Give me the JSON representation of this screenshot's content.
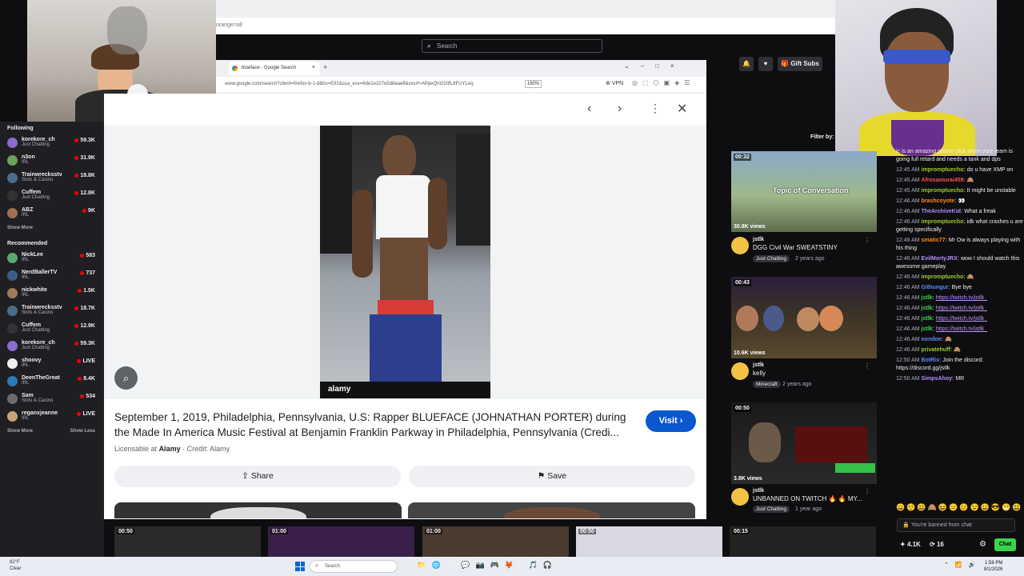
{
  "twitch": {
    "search_placeholder": "Search",
    "gift_subs": "Gift Subs",
    "filter_by": "Filter by:",
    "sidebar": {
      "following_title": "Following",
      "recommended_title": "Recommended",
      "show_more": "Show More",
      "show_less": "Show Less",
      "following": [
        {
          "name": "korekore_ch",
          "category": "Just Chatting",
          "viewers": "59.3K",
          "color": "#8a6bd1"
        },
        {
          "name": "n3on",
          "category": "IRL",
          "viewers": "31.9K",
          "color": "#6aa35b"
        },
        {
          "name": "Trainwrecksstv",
          "category": "Slots & Casino",
          "viewers": "18.8K",
          "color": "#4b6d8c"
        },
        {
          "name": "Cuffem",
          "category": "Just Chatting",
          "viewers": "12.8K",
          "color": "#333"
        },
        {
          "name": "ABZ",
          "category": "IRL",
          "viewers": "9K",
          "color": "#a06f4f"
        }
      ],
      "recommended": [
        {
          "name": "NickLee",
          "category": "IRL",
          "viewers": "583",
          "color": "#5ca86b"
        },
        {
          "name": "NerdBallerTV",
          "category": "IRL",
          "viewers": "737",
          "color": "#3d5c8a"
        },
        {
          "name": "nickwhite",
          "category": "IRL",
          "viewers": "1.5K",
          "color": "#9c7a5a"
        },
        {
          "name": "Trainwrecksstv",
          "category": "Slots & Casino",
          "viewers": "18.7K",
          "color": "#4b6d8c"
        },
        {
          "name": "Cuffem",
          "category": "Just Chatting",
          "viewers": "12.9K",
          "color": "#333"
        },
        {
          "name": "korekore_ch",
          "category": "Just Chatting",
          "viewers": "59.3K",
          "color": "#8a6bd1"
        },
        {
          "name": "shoovy",
          "category": "IRL",
          "viewers": "LIVE",
          "color": "#eeeeee"
        },
        {
          "name": "DeenTheGreat",
          "category": "IRL",
          "viewers": "8.4K",
          "color": "#2a7ab5"
        },
        {
          "name": "Sam",
          "category": "Slots & Casino",
          "viewers": "534",
          "color": "#6c6c6c"
        },
        {
          "name": "reganxjeanne",
          "category": "IRL",
          "viewers": "LIVE",
          "color": "#c9a27a"
        }
      ]
    },
    "videos": [
      {
        "duration": "00:32",
        "views": "30.8K views",
        "channel": "jstlk",
        "title": "DGG Civil War SWEATSTINY",
        "tag": "Just Chatting",
        "ago": "2 years ago",
        "overlay": "Topic of Conversation"
      },
      {
        "duration": "00:43",
        "views": "10.6K views",
        "channel": "jstlk",
        "title": "kelly",
        "tag": "Minecraft",
        "ago": "2 years ago"
      },
      {
        "duration": "00:50",
        "views": "3.8K views",
        "channel": "jstlk",
        "title": "UNBANNED ON TWITCH 🔥 🔥 MY...",
        "tag": "Just Chatting",
        "ago": "1 year ago"
      }
    ],
    "chat": [
      {
        "time": "",
        "user": "",
        "color": "#efeff1",
        "text": "ic is an amazing pocket pick when your team is going full retard and needs a tank and dps"
      },
      {
        "time": "12:45 AM",
        "user": "impromptuecho:",
        "color": "#9acd32",
        "text": "do u have XMP on"
      },
      {
        "time": "12:45 AM",
        "user": "Afrosamurai459:",
        "color": "#ff4d4d",
        "text": "🙈"
      },
      {
        "time": "12:45 AM",
        "user": "impromptuecho:",
        "color": "#9acd32",
        "text": "It might be unstable"
      },
      {
        "time": "12:46 AM",
        "user": "brashcoyote:",
        "color": "#ff8c1a",
        "text": "👀"
      },
      {
        "time": "12:46 AM",
        "user": "TheArchiveKid:",
        "color": "#b58cff",
        "text": "What a freak"
      },
      {
        "time": "12:46 AM",
        "user": "impromptuecho:",
        "color": "#9acd32",
        "text": "idk what crashes u are getting specifically"
      },
      {
        "time": "12:46 AM",
        "user": "smatic77:",
        "color": "#ff8c1a",
        "text": "Mr Ow is always playing with his thing"
      },
      {
        "time": "12:46 AM",
        "user": "EvilMortyJRX:",
        "color": "#b58cff",
        "text": "wow I should watch this awesome gameplay"
      },
      {
        "time": "12:46 AM",
        "user": "impromptuecho:",
        "color": "#9acd32",
        "text": "🙈"
      },
      {
        "time": "12:46 AM",
        "user": "Githungur:",
        "color": "#5a8cff",
        "text": "Bye bye"
      },
      {
        "time": "12:46 AM",
        "user": "jstlk:",
        "color": "#3ad44a",
        "text": "https://twitch.tv/jstlk_",
        "link": true
      },
      {
        "time": "12:46 AM",
        "user": "jstlk:",
        "color": "#3ad44a",
        "text": "https://twitch.tv/jstlk_",
        "link": true
      },
      {
        "time": "12:46 AM",
        "user": "jstlk:",
        "color": "#3ad44a",
        "text": "https://twitch.tv/jstlk_",
        "link": true
      },
      {
        "time": "12:46 AM",
        "user": "jstlk:",
        "color": "#3ad44a",
        "text": "https://twitch.tv/jstlk_",
        "link": true
      },
      {
        "time": "12:46 AM",
        "user": "nondoe:",
        "color": "#5a8cff",
        "text": "🙈"
      },
      {
        "time": "12:46 AM",
        "user": "privatehuff:",
        "color": "#9acd32",
        "text": "🙈"
      },
      {
        "time": "12:50 AM",
        "user": "BotRix:",
        "color": "#5a8cff",
        "text": "Join the discord: https://discord.gg/jstlk"
      },
      {
        "time": "12:50 AM",
        "user": "SimpsAhoy:",
        "color": "#b58cff",
        "text": "MR"
      }
    ],
    "chat_input_placeholder": "You're banned from chat",
    "points": "4.1K",
    "points2": "16",
    "chat_button": "Chat",
    "bottom_thumbs": [
      "00:50",
      "01:00",
      "01:00",
      "00:50",
      "00:15"
    ]
  },
  "browser": {
    "tab_title": "blueface - Google Search",
    "url": "www.google.com/search?client=firefox-b-1-d&hs=E91&sca_esv=6de1e227e5d8aae8&sxsrf=APpeQnt200fL8FUYLeq",
    "zoom": "160%",
    "vpn_label": "VPN",
    "top_url_fragment": "orange=all"
  },
  "viewer": {
    "caption": "September 1, 2019, Philadelphia, Pennsylvania, U.S: Rapper BLUEFACE (JOHNATHAN PORTER) during the Made In America Music Festival at Benjamin Franklin Parkway in Philadelphia, Pennsylvania (Credi...",
    "visit_label": "Visit",
    "licensable_prefix": "Licensable at",
    "licensable_site": "Alamy",
    "credit": "Credit: Alamy",
    "share_label": "Share",
    "save_label": "Save",
    "image_watermark": "alamy"
  },
  "taskbar": {
    "weather_temp": "82°F",
    "weather_desc": "Clear",
    "search_placeholder": "Search",
    "time": "1:58 PM",
    "date": "8/1/2026"
  }
}
